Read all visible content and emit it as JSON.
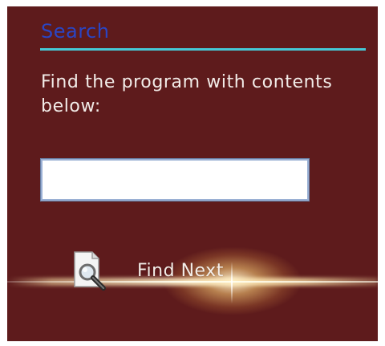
{
  "panel": {
    "title": "Search",
    "prompt": "Find the program with contents below:",
    "search_input": {
      "value": "",
      "placeholder": ""
    },
    "find_next_label": "Find Next",
    "find_icon": "magnifier-document-icon"
  },
  "colors": {
    "background": "#5e1b1c",
    "title": "#2a45c4",
    "title_rule": "#46c8d6",
    "text": "#f2ece8",
    "input_border": "#9ab0d4",
    "glow": "#ffe9b0"
  }
}
